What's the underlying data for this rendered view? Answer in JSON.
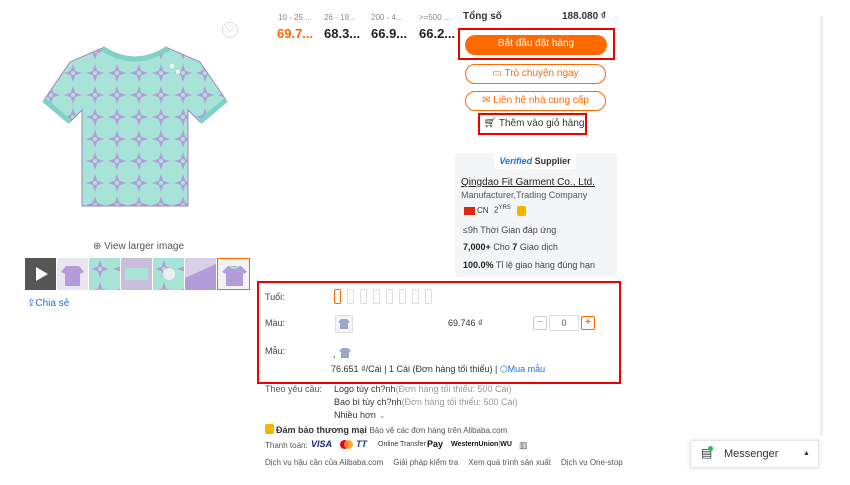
{
  "gallery": {
    "view_larger": "View larger image",
    "share": "Chia sẻ",
    "thumb_count": 7,
    "colors": {
      "lilac": "#b49bd9",
      "mint": "#9fe0d4"
    }
  },
  "price_tiers": [
    {
      "range": "10 - 25 ...",
      "price": "69.7..."
    },
    {
      "range": "26 - 19...",
      "price": "68.3..."
    },
    {
      "range": "200 - 4...",
      "price": "66.9..."
    },
    {
      "range": ">=500 ...",
      "price": "66.2..."
    }
  ],
  "summary": {
    "total_label": "Tổng số",
    "total_value": "188.080 ₫"
  },
  "actions": {
    "start_order": "Bắt đầu đặt hàng",
    "chat_now": "Trò chuyện ngay",
    "contact_supplier": "Liên hệ nhà cung cấp",
    "add_to_cart": "Thêm vào giỏ hàng"
  },
  "supplier": {
    "badge_v": "Verified",
    "badge_rest": " Supplier",
    "name": "Qingdao Fit Garment Co., Ltd.",
    "type": "Manufacturer,Trading Company",
    "country": "CN",
    "years": "2",
    "years_unit": "YRS",
    "response": {
      "value": "≤9h",
      "label": " Thời Gian đáp ứng"
    },
    "orders": {
      "value": "7,000+",
      "mid": " Cho ",
      "count": "7",
      "label": " Giao dịch"
    },
    "ontime": {
      "value": "100.0%",
      "label": " Tỉ lệ giao hàng đúng hạn"
    }
  },
  "variations": {
    "age_label": "Tuổi:",
    "age_option_count": 8,
    "color_label": "Màu:",
    "color_price": "69.746 ₫",
    "quantity": "0",
    "minus": "−",
    "plus": "+",
    "sample_label": "Mẫu:",
    "sample_sep": ",",
    "sample_price": "76.651 ₫/Cái | 1 Cái (Đơn hàng tối thiểu) |",
    "sample_buy": "Mua mẫu"
  },
  "customization": {
    "label": "Theo yêu cầu:",
    "lines": [
      {
        "text": "Logo tùy ch?nh",
        "note": "(Đơn hàng tối thiểu: 500 Cái)"
      },
      {
        "text": "Bao bì tùy ch?nh",
        "note": "(Đơn hàng tối thiểu: 500 Cái)"
      }
    ],
    "more": "Nhiều hơn"
  },
  "guarantee": {
    "title": "Đảm bảo thương mại",
    "desc": "Bảo vệ các đơn hàng trên Alibaba.com"
  },
  "payment": {
    "label": "Thanh toán:",
    "methods": [
      "VISA",
      "TT",
      "Online Transfer",
      "Pay",
      "WesternUnion",
      "WU"
    ]
  },
  "services": [
    "Dịch vụ hậu cần của Alibaba.com",
    "Giải pháp kiểm tra",
    "Xem quá trình sản xuất",
    "Dịch vụ One-stop"
  ],
  "messenger": {
    "label": "Messenger"
  },
  "colors": {
    "accent": "#ff6a00",
    "highlight": "#e00000",
    "link": "#1e6fd9"
  }
}
